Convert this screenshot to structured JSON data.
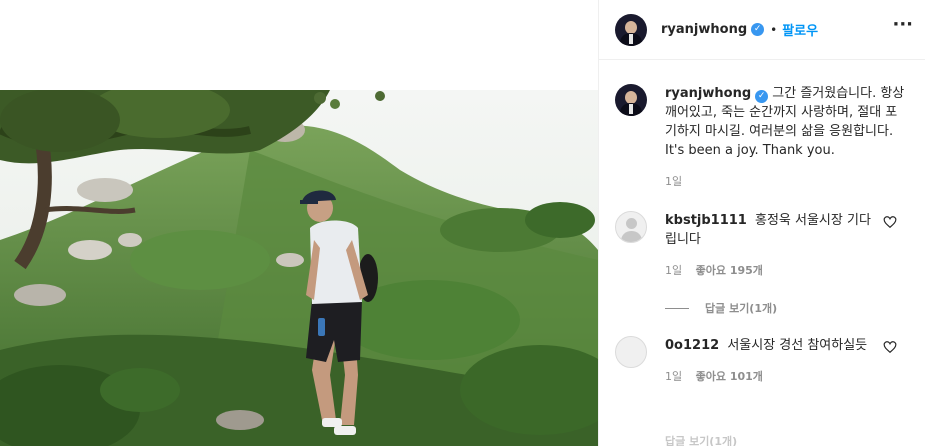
{
  "post": {
    "username": "ryanjwhong",
    "verified_icon": "verified-badge-icon",
    "dot": "•",
    "follow_label": "팔로우",
    "more_icon": "more-options-icon",
    "more_glyph": "···"
  },
  "caption": {
    "username": "ryanjwhong",
    "text": "그간 즐거웠습니다. 항상 깨어있고, 죽는 순간까지 사랑하며, 절대 포기하지 마시길. 여러분의 삶을 응원합니다. It's been a joy. Thank you.",
    "time": "1일"
  },
  "comments": [
    {
      "username": "kbstjb1111",
      "text": "홍정욱 서울시장 기다립니다",
      "time": "1일",
      "likes": "좋아요 195개",
      "replies_label": "답글 보기(1개)"
    },
    {
      "username": "0o1212",
      "text": "서울시장 경선 참여하실듯",
      "time": "1일",
      "likes": "좋아요 101개"
    }
  ],
  "cutoff_text": "답글 보기(1개)",
  "colors": {
    "accent": "#0095f6",
    "verified": "#3897f0",
    "meta": "#8e8e8e",
    "text": "#262626"
  }
}
